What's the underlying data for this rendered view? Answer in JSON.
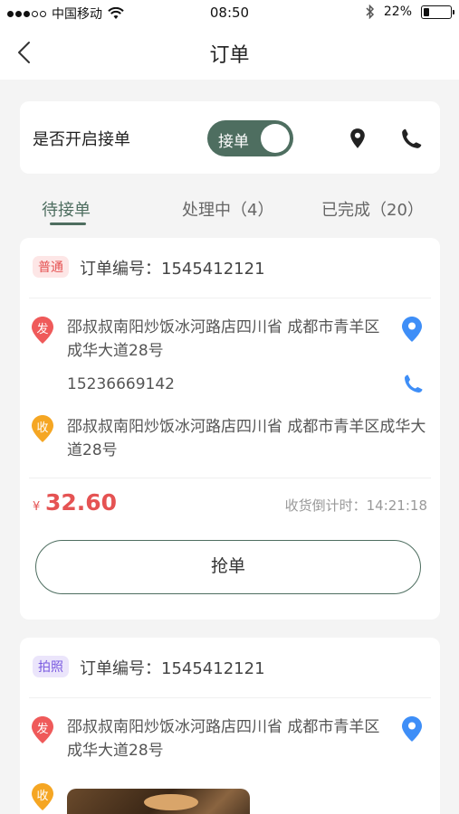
{
  "status_bar": {
    "carrier": "中国移动",
    "time": "08:50",
    "battery": "22%",
    "battery_level": 0.22
  },
  "nav": {
    "title": "订单",
    "back_icon": "chevron-left-icon"
  },
  "toggle_card": {
    "label": "是否开启接单",
    "switch_label": "接单",
    "switch_on": true,
    "location_icon": "map-pin-icon",
    "phone_icon": "phone-icon"
  },
  "tabs": [
    {
      "label": "待接单",
      "active": true
    },
    {
      "label": "处理中（4）",
      "active": false
    },
    {
      "label": "已完成（20）",
      "active": false
    }
  ],
  "orders": [
    {
      "tag": "普通",
      "order_no": "订单编号：1545412121",
      "sender_marker": "发",
      "sender_address": "邵叔叔南阳炒饭冰河路店四川省 成都市青羊区成华大道28号",
      "sender_phone": "15236669142",
      "receiver_marker": "收",
      "receiver_address": "邵叔叔南阳炒饭冰河路店四川省 成都市青羊区成华大道28号",
      "currency": "¥",
      "price": "32.60",
      "countdown": "收货倒计时：14:21:18",
      "button": "抢单"
    },
    {
      "tag": "拍照",
      "order_no": "订单编号：1545412121",
      "sender_marker": "发",
      "sender_address": "邵叔叔南阳炒饭冰河路店四川省 成都市青羊区成华大道28号",
      "receiver_marker": "收"
    }
  ],
  "colors": {
    "brand": "#4e6e60",
    "price": "#e55353",
    "sender_marker": "#ef5a5a",
    "receiver_marker": "#f5a623",
    "location_blue": "#3e8ef7"
  }
}
